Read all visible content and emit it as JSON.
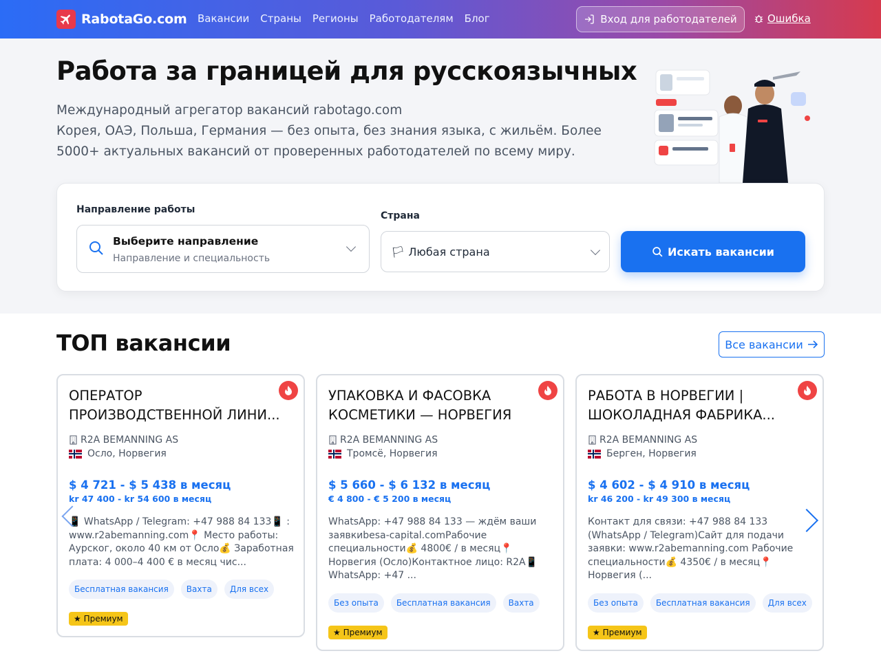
{
  "header": {
    "logo_text": "RabotaGo.com",
    "nav": [
      "Вакансии",
      "Страны",
      "Регионы",
      "Работодателям",
      "Блог"
    ],
    "employer_login": "Вход для работодателей",
    "error_link": "Ошибка"
  },
  "hero": {
    "title": "Работа за границей для русскоязычных",
    "line1": "Международный агрегатор вакансий rabotago.com",
    "line2": "Корея, ОАЭ, Польша, Германия — без опыта, без знания языка, с жильём. Более 5000+ актуальных вакансий от проверенных работодателей по всему миру."
  },
  "search": {
    "direction_label": "Направление работы",
    "direction_title": "Выберите направление",
    "direction_sub": "Направление и специальность",
    "country_label": "Страна",
    "country_value": "🏳 Любая страна",
    "button": "Искать вакансии"
  },
  "top": {
    "title": "ТОП вакансии",
    "all_button": "Все вакансии"
  },
  "cards": [
    {
      "title": "ОПЕРАТОР ПРОИЗВОДСТВЕННОЙ ЛИНИ...",
      "company": "R2A BEMANNING AS",
      "location": "Осло, Норвегия",
      "salary": "$ 4 721 - $ 5 438 в месяц",
      "salary_local": "kr 47 400 - kr 54 600 в месяц",
      "desc": "📱 WhatsApp / Telegram: +47 988 84 133📱 : www.r2abemanning.com📍 Место работы: Аурског, около 40 км от Осло💰 Заработная плата: 4 000–4 400 € в месяц чис...",
      "tags": [
        "Бесплатная вакансия",
        "Вахта",
        "Для всех"
      ],
      "premium": "★ Премиум"
    },
    {
      "title": "УПАКОВКА И ФАСОВКА КОСМЕТИКИ — НОРВЕГИЯ",
      "company": "R2A BEMANNING AS",
      "location": "Тромсё, Норвегия",
      "salary": "$ 5 660 - $ 6 132 в месяц",
      "salary_local": "€ 4 800 - € 5 200 в месяц",
      "desc": "WhatsApp: +47 988 84 133 — ждём ваши заявкиbesa-capital.comРабочие специальности💰 4800€ / в месяц📍 Норвегия (Осло)Контактное лицо: R2A📱 WhatsApp: +47 ...",
      "tags": [
        "Без опыта",
        "Бесплатная вакансия",
        "Вахта"
      ],
      "premium": "★ Премиум"
    },
    {
      "title": "РАБОТА В НОРВЕГИИ | ШОКОЛАДНАЯ ФАБРИКА...",
      "company": "R2A BEMANNING AS",
      "location": "Берген, Норвегия",
      "salary": "$ 4 602 - $ 4 910 в месяц",
      "salary_local": "kr 46 200 - kr 49 300 в месяц",
      "desc": "Контакт для связи: +47 988 84 133 (WhatsApp / Telegram)Сайт для подачи заявки: www.r2abemanning.com Рабочие специальности💰 4350€ / в месяц📍 Норвегия (...",
      "tags": [
        "Без опыта",
        "Бесплатная вакансия",
        "Для всех"
      ],
      "premium": "★ Премиум"
    }
  ],
  "colors": {
    "accent": "#1971f0",
    "brand_red": "#e8394b",
    "premium": "#f5c518"
  }
}
